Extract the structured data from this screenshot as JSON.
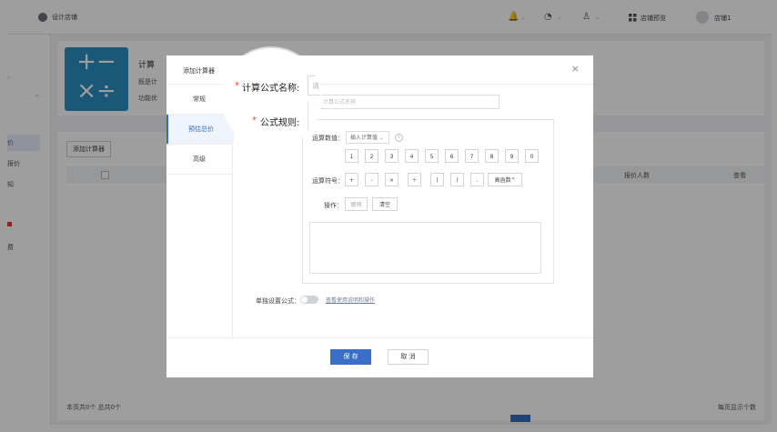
{
  "topbar": {
    "logo_text": "设计店铺",
    "bell_icon": "🔔",
    "support_icon": "◔",
    "user_icon": "♙",
    "caret": "⌄",
    "store_preview_label": "店铺预览",
    "username": "店铺1"
  },
  "sidebar": {
    "items": [
      "价",
      "报价",
      "知",
      "费"
    ]
  },
  "page": {
    "calc_title": "计算",
    "calc_desc1": "既是计",
    "calc_desc2": "功能优",
    "add_calc_button": "添加计算器",
    "columns": {
      "quote_people": "报价人数",
      "view": "查看"
    },
    "footer_left": "本页共0个  总共0个",
    "footer_right": "每页显示个数"
  },
  "modal": {
    "title": "添加计算器",
    "close": "×",
    "nav": [
      {
        "label": "常规"
      },
      {
        "label": "预估总价"
      },
      {
        "label": "高级"
      }
    ],
    "name_placeholder": "计算公式名称",
    "values_label": "运算数值：",
    "insert_calc_value": "插入计算值",
    "info": "i",
    "digits": [
      "1",
      "2",
      "3",
      "4",
      "5",
      "6",
      "7",
      "8",
      "9",
      "0"
    ],
    "operators_label": "运算符号：",
    "operators": [
      "+",
      "-",
      "×",
      "÷",
      "(",
      ")",
      "."
    ],
    "advanced_func": "高函数^",
    "ops_label": "操作：",
    "undo": "撤销",
    "clear": "清空",
    "separate_formula_label": "单独设置公式：",
    "help_link": "查看使用说明和操作",
    "save": "保 存",
    "cancel": "取 消"
  },
  "magnifier": {
    "star": "*",
    "formula_name_label": "计算公式名称:",
    "formula_rule_label": "公式规则:",
    "input_hint": "请"
  }
}
